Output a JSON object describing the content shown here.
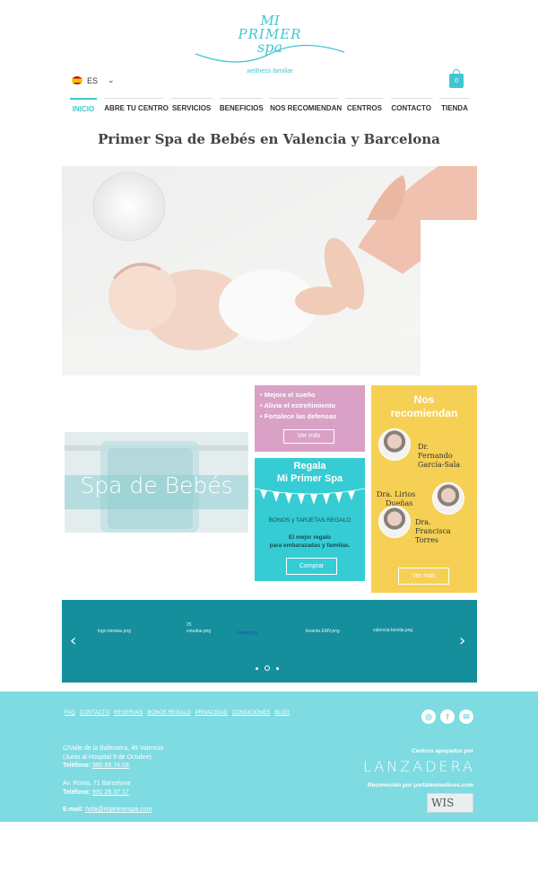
{
  "brand": {
    "logo_line1": "MI",
    "logo_line2": "PRIMER",
    "logo_line3": "spa",
    "tagline": "wellness familiar",
    "accent": "#3fc8d1"
  },
  "header": {
    "language": "ES",
    "cart_count": "0"
  },
  "nav": [
    "INICIO",
    "ABRE TU CENTRO",
    "SERVICIOS",
    "BENEFICIOS",
    "NOS RECOMIENDAN",
    "CENTROS",
    "CONTACTO",
    "TIENDA"
  ],
  "headline": "Primer Spa de Bebés en Valencia y Barcelona",
  "spa_tile": {
    "title": "Spa de Bebés"
  },
  "benefits": {
    "items": [
      "Mejora el sueño",
      "Alivia el estreñimiento",
      "Fortalece las defensas"
    ],
    "button": "Ver más",
    "color": "#d9a1c6"
  },
  "regala": {
    "title_line1": "Regala",
    "title_line2": "Mi Primer Spa",
    "subtitle": "BONOS y TARJETAS REGALO",
    "desc_line1": "El mejor regalo",
    "desc_line2": "para embarazadas y familias.",
    "button": "Comprar",
    "color": "#36ccd4"
  },
  "recommend": {
    "title_line1": "Nos",
    "title_line2": "recomiendan",
    "doctors": [
      {
        "line1": "Dr.",
        "line2": "Fernando",
        "line3": "García-Sala"
      },
      {
        "line1": "Dra. Lirios",
        "line2": "Dueñas"
      },
      {
        "line1": "Dra.",
        "line2": "Francisca",
        "line3": "Torres"
      }
    ],
    "button": "Ver más",
    "color": "#f5d054"
  },
  "carousel": {
    "items": [
      "logo-tiendas.png",
      "25",
      "estudiar.png",
      "el.pais.png",
      "levante.EMV.png",
      "valencia-familia.png"
    ],
    "color": "#168f9c"
  },
  "footer": {
    "links": [
      "FAQ",
      "CONTACTO",
      "RESERVAS",
      "BONOS REGALO",
      "PRIVACIDAD",
      "CONDICIONES",
      "BLOG"
    ],
    "social": [
      "instagram-icon",
      "facebook-icon",
      "email-icon"
    ],
    "address1_line1": "C/Valle de la Ballestera, 49 Valencia",
    "address1_line2": "(Junto al Hospital 9 de Octubre)",
    "phone_label": "Teléfono:",
    "phone1": "960 66 74 03",
    "address2_line1": "Av. Roma, 71 Barcelona",
    "phone2": "931 26 37 17",
    "email_label": "E-mail:",
    "email": "hola@miprimerspa.com",
    "supported_by": "Centros apoyados por",
    "lanzadera": "LANZADERA",
    "recognized": "Reconocido por portalesmedicos.com",
    "badge": "WIS",
    "color": "#7edbe1"
  }
}
